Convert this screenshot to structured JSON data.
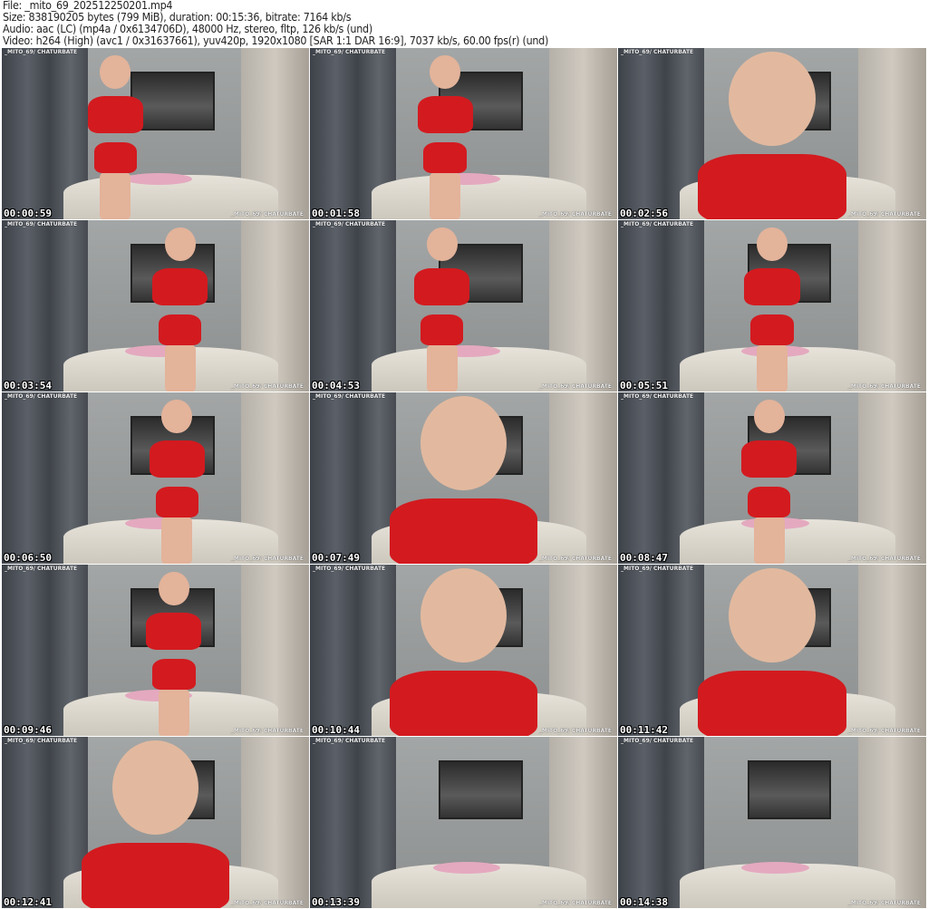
{
  "header": {
    "file": "File: _mito_69_202512250201.mp4",
    "size": "Size: 838190205 bytes (799 MiB), duration: 00:15:36, bitrate: 7164 kb/s",
    "audio": "Audio: aac (LC) (mp4a / 0x6134706D), 48000 Hz, stereo, fltp, 126 kb/s (und)",
    "video": "Video: h264 (High) (avc1 / 0x31637661), yuv420p, 1920x1080 [SAR 1:1 DAR 16:9], 7037 kb/s, 60.00 fps(r) (und)"
  },
  "watermark": "_MITO_69/ CHATURBATE",
  "thumbnails": [
    {
      "timestamp": "00:00:59",
      "person": true,
      "closeup": false
    },
    {
      "timestamp": "00:01:58",
      "person": true,
      "closeup": false
    },
    {
      "timestamp": "00:02:56",
      "person": true,
      "closeup": true
    },
    {
      "timestamp": "00:03:54",
      "person": true,
      "closeup": false
    },
    {
      "timestamp": "00:04:53",
      "person": true,
      "closeup": false
    },
    {
      "timestamp": "00:05:51",
      "person": true,
      "closeup": false
    },
    {
      "timestamp": "00:06:50",
      "person": true,
      "closeup": false
    },
    {
      "timestamp": "00:07:49",
      "person": true,
      "closeup": true
    },
    {
      "timestamp": "00:08:47",
      "person": true,
      "closeup": false
    },
    {
      "timestamp": "00:09:46",
      "person": true,
      "closeup": false
    },
    {
      "timestamp": "00:10:44",
      "person": true,
      "closeup": true
    },
    {
      "timestamp": "00:11:42",
      "person": true,
      "closeup": true
    },
    {
      "timestamp": "00:12:41",
      "person": true,
      "closeup": true
    },
    {
      "timestamp": "00:13:39",
      "person": false,
      "closeup": false
    },
    {
      "timestamp": "00:14:38",
      "person": false,
      "closeup": false
    }
  ]
}
